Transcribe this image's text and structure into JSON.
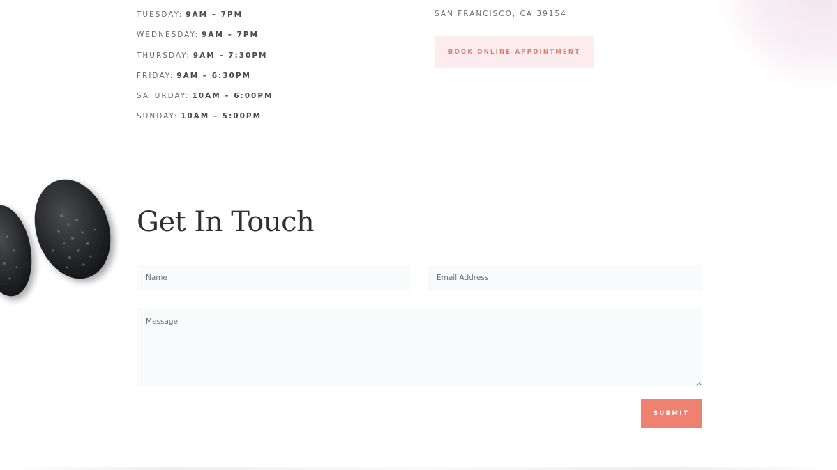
{
  "hours": [
    {
      "day": "Tuesday:",
      "time": "9am – 7pm"
    },
    {
      "day": "Wednesday:",
      "time": "9am – 7pm"
    },
    {
      "day": "Thursday:",
      "time": "9am – 7:30pm"
    },
    {
      "day": "Friday:",
      "time": "9am – 6:30pm"
    },
    {
      "day": "Saturday:",
      "time": "10am – 6:00pm"
    },
    {
      "day": "Sunday:",
      "time": "10am – 5:00pm"
    }
  ],
  "location": {
    "address": "San Francisco, CA 39154",
    "book_button": "Book Online Appointment"
  },
  "contact": {
    "title": "Get In Touch",
    "name_placeholder": "Name",
    "email_placeholder": "Email Address",
    "message_placeholder": "Message",
    "submit_label": "Submit"
  },
  "colors": {
    "accent": "#ef8170",
    "book_button_bg": "#fcecef",
    "book_button_text": "#e07d6c",
    "field_bg": "#f9fafb"
  }
}
